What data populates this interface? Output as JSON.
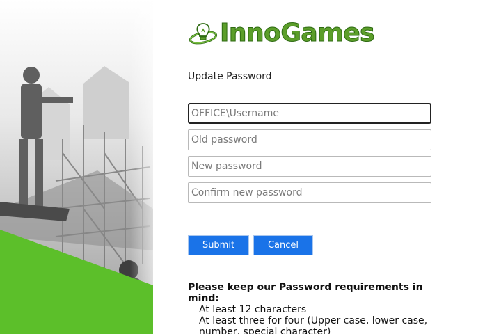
{
  "brand": {
    "logo_text": "InnoGames",
    "logo_color": "#5c9e2a",
    "accent_green": "#5cbf2a"
  },
  "form": {
    "title": "Update Password",
    "username_placeholder": "OFFICE\\Username",
    "old_password_placeholder": "Old password",
    "new_password_placeholder": "New password",
    "confirm_password_placeholder": "Confirm new password",
    "submit_label": "Submit",
    "cancel_label": "Cancel",
    "button_color": "#1a73e8"
  },
  "requirements": {
    "heading": "Please keep our Password requirements in mind:",
    "items": [
      "At least 12 characters",
      "At least three for four (Upper case, lower case, number, special character)"
    ]
  },
  "icons": {
    "logo_mark": "lightbulb-orbit-icon"
  }
}
